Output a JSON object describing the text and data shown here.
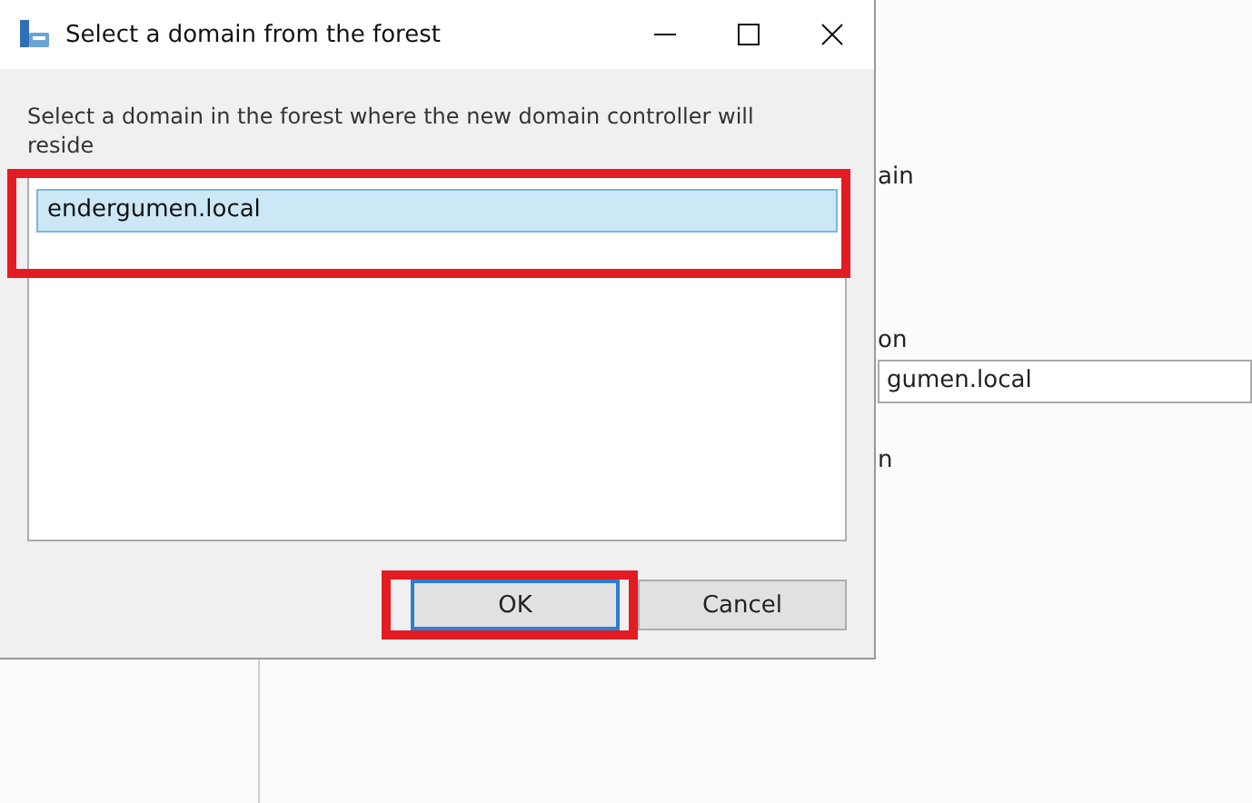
{
  "background_window": {
    "items": [
      {
        "kind": "label",
        "text": "ain"
      },
      {
        "kind": "label",
        "text": "on"
      },
      {
        "kind": "field",
        "value": "gumen.local"
      },
      {
        "kind": "label",
        "text": "n"
      }
    ]
  },
  "dialog": {
    "title": "Select a domain from the forest",
    "instruction": "Select a domain in the forest where the new domain controller will reside",
    "list_highlighted": true,
    "domains": [
      {
        "name": "endergumen.local",
        "selected": true
      }
    ],
    "buttons": [
      {
        "label": "OK",
        "focused": true,
        "highlighted": true
      },
      {
        "label": "Cancel",
        "focused": false,
        "highlighted": false
      }
    ]
  }
}
